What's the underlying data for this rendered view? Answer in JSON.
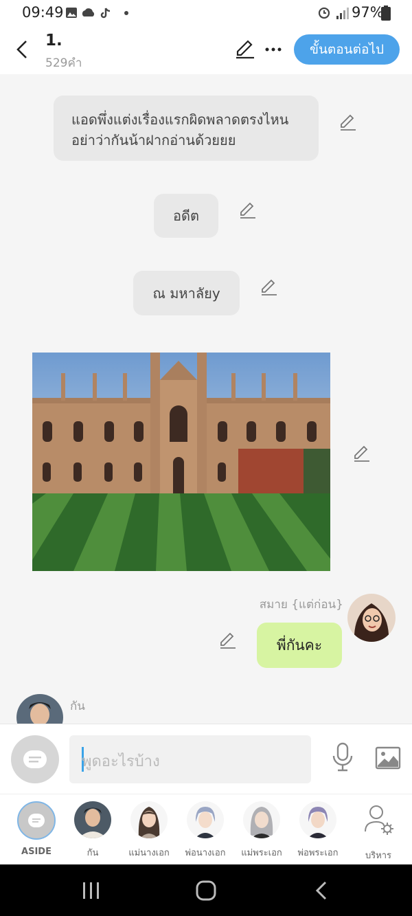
{
  "status_bar": {
    "time": "09:49",
    "battery": "97%"
  },
  "header": {
    "chapter_title": "1.",
    "word_count": "529คำ",
    "next_button": "ขั้นตอนต่อไป"
  },
  "messages": {
    "narration_1": [
      "แอดพึ่งแต่งเรื่องแรกผิดพลาดตรงไหน",
      "อย่าว่ากันน้าฝากอ่านด้วยยย"
    ],
    "narration_2": "อดีต",
    "narration_3": "ณ มหาลัยy",
    "char_msg_sender": "สมาย {แต่ก่อน}",
    "char_msg_text": "พี่กันคะ",
    "next_sender": "กัน"
  },
  "input": {
    "placeholder": "พูดอะไรบ้าง"
  },
  "characters": [
    {
      "name": "ASIDE",
      "selected": true
    },
    {
      "name": "กัน"
    },
    {
      "name": "แม่นางเอก"
    },
    {
      "name": "พ่อนางเอก"
    },
    {
      "name": "แม่พระเอก"
    },
    {
      "name": "พ่อพระเอก"
    },
    {
      "name": "บริหาร"
    }
  ],
  "colors": {
    "accent": "#4da3ea",
    "green_bubble": "#d7f4a2",
    "grey_bubble": "#e8e8e8"
  }
}
